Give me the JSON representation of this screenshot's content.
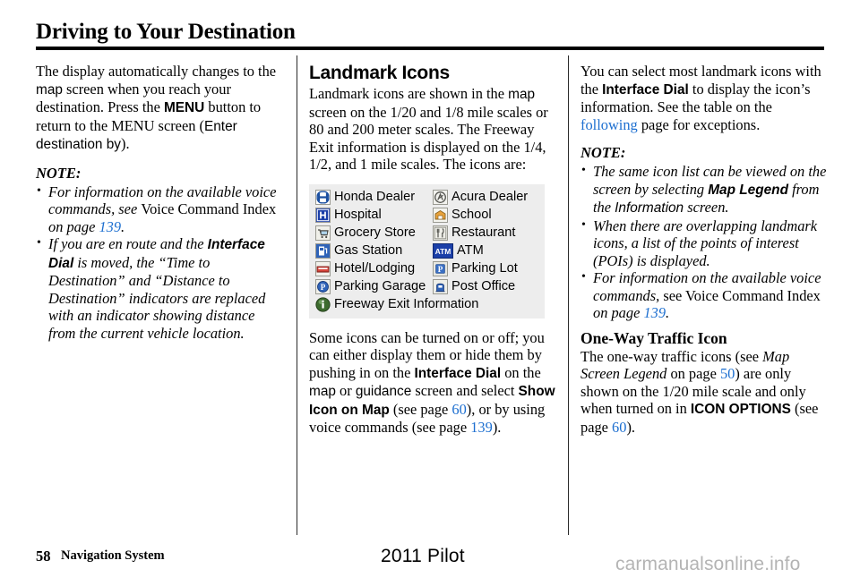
{
  "document": {
    "title": "Driving to Your Destination",
    "footer": {
      "page_number": "58",
      "section": "Navigation System",
      "model": "2011 Pilot",
      "watermark": "carmanualsonline.info"
    }
  },
  "colors": {
    "link": "#1d6fd0",
    "table_background": "#ededed",
    "rule": "#000000",
    "watermark": "#b4b4b4"
  },
  "column_left": {
    "intro": {
      "t1": "The display automatically changes to the ",
      "map": "map",
      "t2": " screen when you reach your destination. Press the ",
      "menu_bold": "MENU",
      "t3": " button to return to the MENU screen (",
      "menu_plain": "MENU",
      "enter_destination_by": "Enter destination by",
      "t4": ")."
    },
    "note_label": "NOTE:",
    "notes": [
      {
        "i1": "For information on the available voice commands, see ",
        "u1": "Voice Command Index",
        "i2": " on page ",
        "page": "139",
        "i3": "."
      },
      {
        "i1": "If you are en route and the ",
        "b1": "Interface Dial",
        "i2": " is moved, the “Time to Destination” and “Distance to Destination” indicators are replaced with an indicator showing distance from the current vehicle location."
      }
    ]
  },
  "column_middle": {
    "heading": "Landmark Icons",
    "intro": {
      "t1": "Landmark icons are shown in the ",
      "map": "map",
      "t2": " screen on the 1/20 and 1/8 mile scales or 80 and 200 meter scales. The Freeway Exit information is displayed on the 1/4, 1/2, and 1 mile scales. The icons are:"
    },
    "icon_table": {
      "rows": [
        {
          "left": {
            "icon": "honda-dealer-icon",
            "label": "Honda Dealer"
          },
          "right": {
            "icon": "acura-dealer-icon",
            "label": "Acura Dealer"
          }
        },
        {
          "left": {
            "icon": "hospital-icon",
            "label": "Hospital"
          },
          "right": {
            "icon": "school-icon",
            "label": "School"
          }
        },
        {
          "left": {
            "icon": "grocery-store-icon",
            "label": "Grocery Store"
          },
          "right": {
            "icon": "restaurant-icon",
            "label": "Restaurant"
          }
        },
        {
          "left": {
            "icon": "gas-station-icon",
            "label": "Gas Station"
          },
          "right": {
            "icon": "atm-icon",
            "label": "ATM"
          }
        },
        {
          "left": {
            "icon": "hotel-lodging-icon",
            "label": "Hotel/Lodging"
          },
          "right": {
            "icon": "parking-lot-icon",
            "label": "Parking Lot"
          }
        },
        {
          "left": {
            "icon": "parking-garage-icon",
            "label": "Parking Garage"
          },
          "right": {
            "icon": "post-office-icon",
            "label": "Post Office"
          }
        }
      ],
      "full_row": {
        "icon": "freeway-exit-information-icon",
        "label": "Freeway Exit Information"
      }
    },
    "outro": {
      "t1": "Some icons can be turned on or off; you can either display them or hide them by pushing in on the ",
      "b1": "Interface Dial",
      "t2": " on the ",
      "s1": "map",
      "t3": " or ",
      "s2": "guidance",
      "t4": " screen and select ",
      "b2": "Show Icon on Map",
      "t5": " (see page ",
      "page1": "60",
      "t6": "), or by using voice commands (see page ",
      "page2": "139",
      "t7": ")."
    }
  },
  "column_right": {
    "intro": {
      "t1": "You can select most landmark icons with the ",
      "b1": "Interface Dial",
      "t2": " to display the icon’s information. See the table on the ",
      "link": "following",
      "t3": " page for exceptions."
    },
    "note_label": "NOTE:",
    "notes": [
      {
        "i1": "The same icon list can be viewed on the screen by selecting ",
        "b1": "Map Legend",
        "i2": " from the ",
        "s1": "Information",
        "i3": " screen."
      },
      {
        "i1": "When there are overlapping landmark icons, a list of the points of interest (POIs) is displayed."
      },
      {
        "i1": "For information on the available voice commands, ",
        "u1": "see Voice Command Index",
        "i2": " on page ",
        "page": "139",
        "i3": "."
      }
    ],
    "one_way": {
      "heading": "One-Way Traffic Icon",
      "t1": "The one-way traffic icons (see ",
      "it1": "Map Screen Legend",
      "t2": " on page ",
      "page1": "50",
      "t3": ") are only shown on the 1/20 mile scale and only when turned on in ",
      "b1": "ICON OPTIONS",
      "t4": " (see page ",
      "page2": "60",
      "t5": ")."
    }
  }
}
